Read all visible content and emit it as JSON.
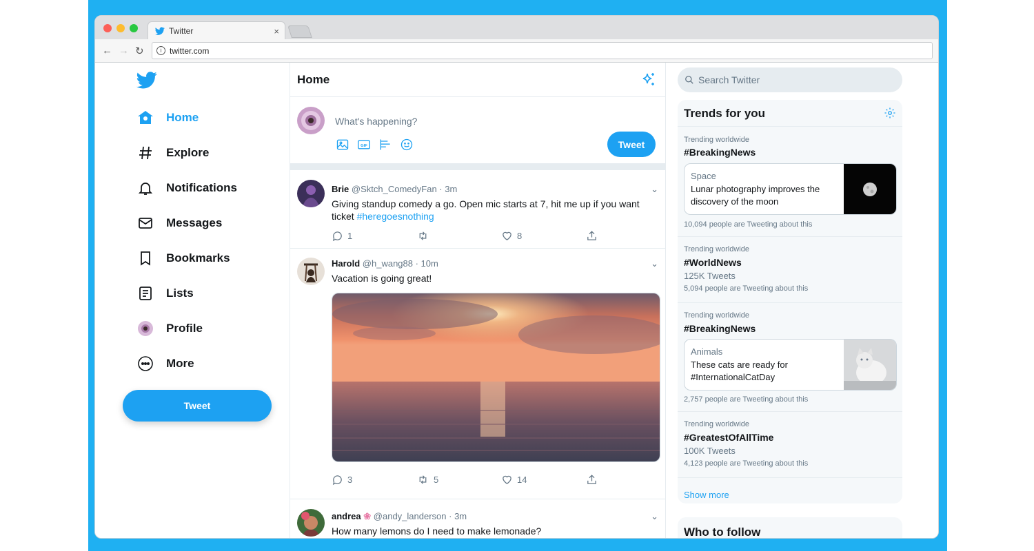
{
  "browser": {
    "tab_title": "Twitter",
    "tab_close": "×",
    "url": "twitter.com"
  },
  "nav": {
    "items": [
      {
        "label": "Home",
        "icon": "home-icon"
      },
      {
        "label": "Explore",
        "icon": "hash-icon"
      },
      {
        "label": "Notifications",
        "icon": "bell-icon"
      },
      {
        "label": "Messages",
        "icon": "envelope-icon"
      },
      {
        "label": "Bookmarks",
        "icon": "bookmark-icon"
      },
      {
        "label": "Lists",
        "icon": "list-icon"
      },
      {
        "label": "Profile",
        "icon": "avatar-icon"
      },
      {
        "label": "More",
        "icon": "more-icon"
      }
    ],
    "tweet_button": "Tweet"
  },
  "center": {
    "header": "Home",
    "compose_placeholder": "What's happening?",
    "tweet_button": "Tweet"
  },
  "tweets": [
    {
      "name": "Brie",
      "meta": "@Sktch_ComedyFan · 3m",
      "text": "Giving standup comedy a go. Open mic starts at 7, hit me up if you want ticket ",
      "hashtag": "#heregoesnothing",
      "replies": "1",
      "retweets": "",
      "likes": "8"
    },
    {
      "name": "Harold",
      "meta": "@h_wang88 · 10m",
      "text": "Vacation is going great!",
      "replies": "3",
      "retweets": "5",
      "likes": "14"
    },
    {
      "name": "andrea",
      "meta": "@andy_landerson · 3m",
      "text": "How many lemons do I need to make lemonade?"
    }
  ],
  "right": {
    "search_placeholder": "Search Twitter",
    "trends_title": "Trends for you",
    "trends": [
      {
        "context": "Trending worldwide",
        "tag": "#BreakingNews",
        "card_category": "Space",
        "card_text": "Lunar photography improves the discovery of the moon",
        "footer": "10,094 people are Tweeting about this"
      },
      {
        "context": "Trending worldwide",
        "tag": "#WorldNews",
        "count": "125K Tweets",
        "footer": "5,094 people are Tweeting about this"
      },
      {
        "context": "Trending worldwide",
        "tag": "#BreakingNews",
        "card_category": "Animals",
        "card_text": "These cats are ready for #InternationalCatDay",
        "footer": "2,757 people are Tweeting about this"
      },
      {
        "context": "Trending worldwide",
        "tag": "#GreatestOfAllTime",
        "count": "100K Tweets",
        "footer": "4,123 people are Tweeting about this"
      }
    ],
    "show_more": "Show more",
    "who_to_follow": "Who to follow"
  },
  "colors": {
    "accent": "#1da1f2",
    "frame": "#1fb0f2",
    "secondary_text": "#657786"
  }
}
